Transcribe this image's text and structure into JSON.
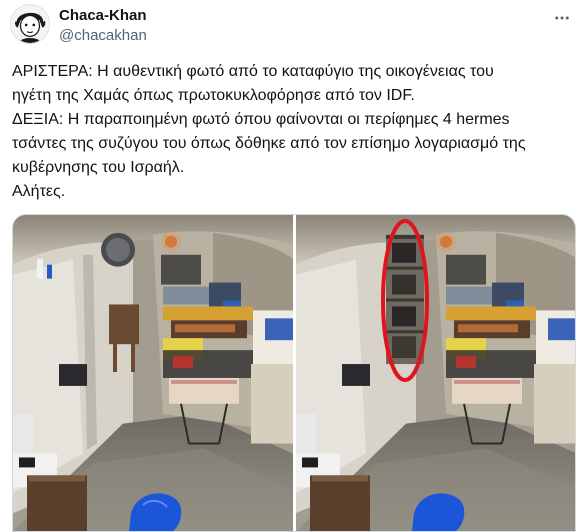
{
  "author": {
    "display_name": "Chaca-Khan",
    "handle": "@chacakhan",
    "avatar_icon": "cartoon-avatar-icon"
  },
  "more_icon": "more-options-icon",
  "tweet": {
    "lines": [
      "ΑΡΙΣΤΕΡΑ: Η αυθεντική φωτό από το καταφύγιο της οικογένειας του",
      "ηγέτη της Χαμάς όπως πρωτοκυκλοφόρησε από τον IDF.",
      "ΔΕΞΙΑ: Η παραποιημένη φωτό όπου φαίνονται οι περίφημες 4 hermes",
      "τσάντες της συζύγου του όπως δόθηκε από τον επίσημο λογαριασμό της",
      "κυβέρνησης του Ισραήλ.",
      "Αλήτες."
    ]
  },
  "colors": {
    "text": "#0f1419",
    "secondary_text": "#536471",
    "border": "#cfd9de",
    "highlight_ring": "#e0141e"
  }
}
